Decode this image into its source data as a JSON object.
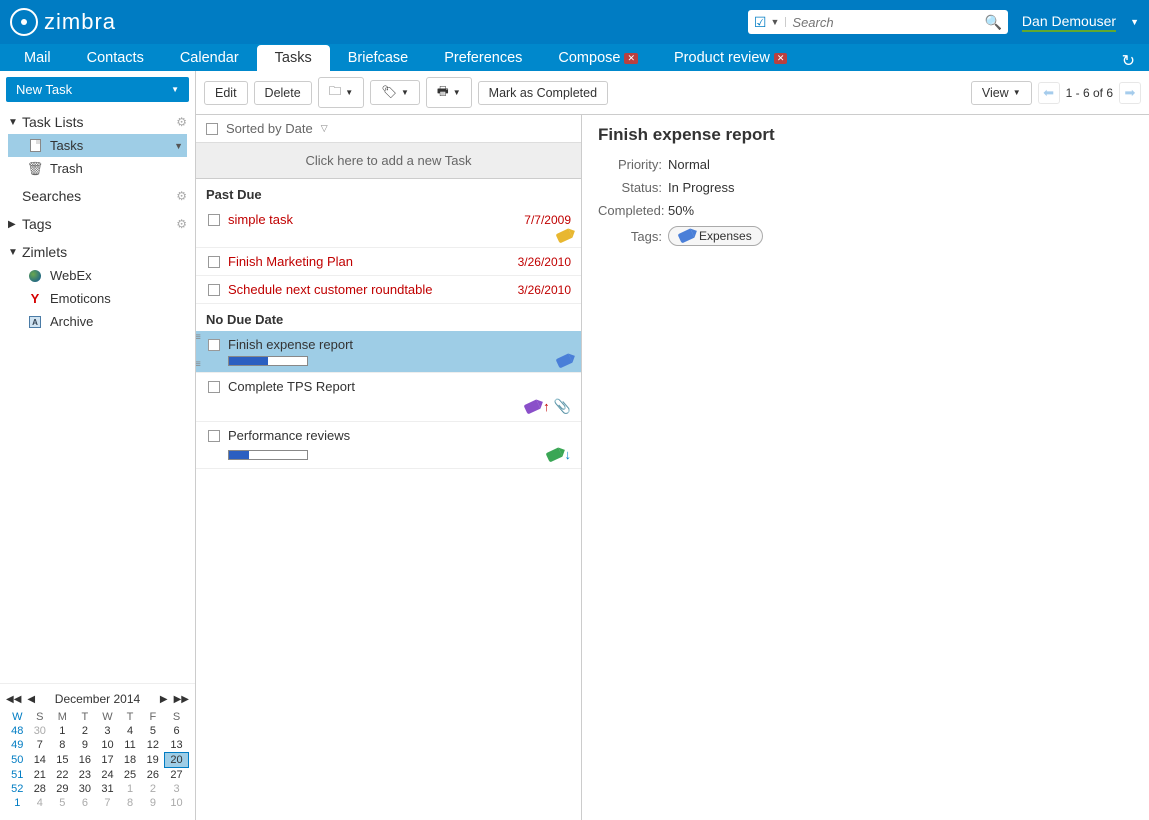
{
  "header": {
    "brand": "zimbra",
    "search_placeholder": "Search",
    "user": "Dan Demouser"
  },
  "tabs": [
    {
      "label": "Mail",
      "active": false,
      "closable": false
    },
    {
      "label": "Contacts",
      "active": false,
      "closable": false
    },
    {
      "label": "Calendar",
      "active": false,
      "closable": false
    },
    {
      "label": "Tasks",
      "active": true,
      "closable": false
    },
    {
      "label": "Briefcase",
      "active": false,
      "closable": false
    },
    {
      "label": "Preferences",
      "active": false,
      "closable": false
    },
    {
      "label": "Compose",
      "active": false,
      "closable": true
    },
    {
      "label": "Product review",
      "active": false,
      "closable": true
    }
  ],
  "sidebar": {
    "new_task": "New Task",
    "task_lists_header": "Task Lists",
    "tasks_item": "Tasks",
    "trash_item": "Trash",
    "searches_header": "Searches",
    "tags_header": "Tags",
    "zimlets_header": "Zimlets",
    "zimlets": [
      {
        "label": "WebEx",
        "icon": "globe"
      },
      {
        "label": "Emoticons",
        "icon": "y"
      },
      {
        "label": "Archive",
        "icon": "arch"
      }
    ]
  },
  "calendar": {
    "title": "December 2014",
    "dow": [
      "W",
      "S",
      "M",
      "T",
      "W",
      "T",
      "F",
      "S"
    ],
    "rows": [
      {
        "wk": "48",
        "days": [
          "30",
          "1",
          "2",
          "3",
          "4",
          "5",
          "6"
        ],
        "om": [
          0
        ]
      },
      {
        "wk": "49",
        "days": [
          "7",
          "8",
          "9",
          "10",
          "11",
          "12",
          "13"
        ],
        "om": []
      },
      {
        "wk": "50",
        "days": [
          "14",
          "15",
          "16",
          "17",
          "18",
          "19",
          "20"
        ],
        "om": [],
        "today_idx": 6
      },
      {
        "wk": "51",
        "days": [
          "21",
          "22",
          "23",
          "24",
          "25",
          "26",
          "27"
        ],
        "om": []
      },
      {
        "wk": "52",
        "days": [
          "28",
          "29",
          "30",
          "31",
          "1",
          "2",
          "3"
        ],
        "om": [
          4,
          5,
          6
        ]
      },
      {
        "wk": "1",
        "days": [
          "4",
          "5",
          "6",
          "7",
          "8",
          "9",
          "10"
        ],
        "om": [
          0,
          1,
          2,
          3,
          4,
          5,
          6
        ]
      }
    ]
  },
  "toolbar": {
    "edit": "Edit",
    "delete": "Delete",
    "mark_completed": "Mark as Completed",
    "view": "View",
    "pager": "1 - 6 of 6"
  },
  "list": {
    "sort_label": "Sorted by Date",
    "add_row": "Click here to add a new Task",
    "groups": [
      {
        "header": "Past Due",
        "tasks": [
          {
            "title": "simple task",
            "date": "7/7/2009",
            "overdue": true,
            "tag": "yellow",
            "progress": null,
            "icons": [
              "tag"
            ]
          },
          {
            "title": "Finish Marketing Plan",
            "date": "3/26/2010",
            "overdue": true,
            "tag": null,
            "progress": null,
            "icons": []
          },
          {
            "title": "Schedule next customer roundtable",
            "date": "3/26/2010",
            "overdue": true,
            "tag": null,
            "progress": null,
            "icons": []
          }
        ]
      },
      {
        "header": "No Due Date",
        "tasks": [
          {
            "title": "Finish expense report",
            "date": "",
            "overdue": false,
            "tag": "blue",
            "progress": 50,
            "selected": true,
            "icons": [
              "tag"
            ]
          },
          {
            "title": "Complete TPS Report",
            "date": "",
            "overdue": false,
            "tag": "purple",
            "progress": null,
            "icons": [
              "tag",
              "up",
              "clip"
            ]
          },
          {
            "title": "Performance reviews",
            "date": "",
            "overdue": false,
            "tag": "green",
            "progress": 25,
            "icons": [
              "tag",
              "down"
            ]
          }
        ]
      }
    ]
  },
  "detail": {
    "title": "Finish expense report",
    "priority_label": "Priority:",
    "priority": "Normal",
    "status_label": "Status:",
    "status": "In Progress",
    "completed_label": "Completed:",
    "completed": "50%",
    "tags_label": "Tags:",
    "tag": "Expenses"
  }
}
